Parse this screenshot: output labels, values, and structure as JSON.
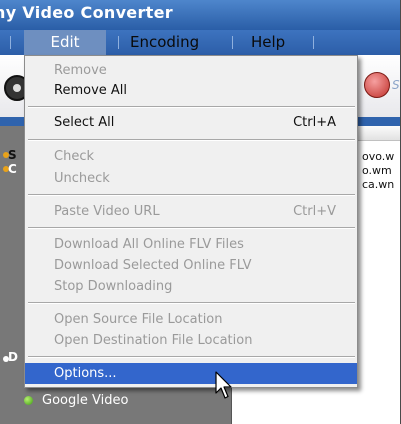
{
  "window": {
    "title": "ny Video Converter"
  },
  "menubar": {
    "items": [
      {
        "label": "Edit"
      },
      {
        "label": "Encoding"
      },
      {
        "label": "Help"
      }
    ]
  },
  "edit_menu": {
    "items": [
      {
        "label": "Remove",
        "enabled": false
      },
      {
        "label": "Remove All",
        "enabled": true
      },
      {
        "label": "Select All",
        "shortcut": "Ctrl+A",
        "enabled": true
      },
      {
        "label": "Check",
        "enabled": false
      },
      {
        "label": "Uncheck",
        "enabled": false
      },
      {
        "label": "Paste Video URL",
        "shortcut": "Ctrl+V",
        "enabled": false
      },
      {
        "label": "Download All Online FLV Files",
        "enabled": false
      },
      {
        "label": "Download Selected Online FLV",
        "enabled": false
      },
      {
        "label": "Stop Downloading",
        "enabled": false
      },
      {
        "label": "Open Source File Location",
        "enabled": false
      },
      {
        "label": "Open Destination File Location",
        "enabled": false
      },
      {
        "label": "Options...",
        "enabled": true,
        "highlighted": true
      }
    ]
  },
  "side_panel": {
    "partial_letters": [
      "S",
      "C",
      "D"
    ],
    "items": [
      {
        "label": "Google Video"
      }
    ]
  },
  "file_list": {
    "rows": [
      "ovo.w",
      "o.wm",
      "ca.wn"
    ]
  },
  "toolbar": {
    "right_label": "S"
  },
  "colors": {
    "title_bar": "#2a5ea7",
    "menu_highlight": "#3366cc",
    "side_panel": "#787878",
    "dropdown_bg": "#f0f0f0"
  },
  "icons": [
    "film-reel-icon",
    "convert-arrow-icon",
    "green-dot-icon",
    "mouse-cursor-icon"
  ]
}
